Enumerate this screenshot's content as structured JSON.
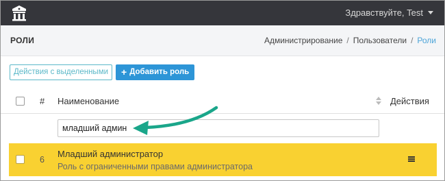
{
  "navbar": {
    "logo_icon": "building-logo-icon",
    "greeting": "Здравствуйте, Test"
  },
  "header": {
    "title": "РОЛИ",
    "breadcrumb": [
      "Администрирование",
      "Пользователи",
      "Роли"
    ],
    "separator": "/"
  },
  "toolbar": {
    "bulk_actions_label": "Действия с выделенными",
    "add_role_label": "Добавить роль",
    "add_icon": "plus-icon"
  },
  "table": {
    "columns": [
      "#",
      "Наименование",
      "Действия"
    ],
    "filter_value": "младший админ",
    "rows": [
      {
        "number": "6",
        "name": "Младший администратор",
        "description": "Роль с ограниченными правами администратора",
        "highlight_color": "#f9d131"
      }
    ]
  },
  "annotation": {
    "arrow_color": "#1aa68a"
  },
  "colors": {
    "navbar_bg": "#35363b",
    "accent_blue": "#2d95d7",
    "outline_teal": "#5bb8c8",
    "row_highlight": "#f9d131"
  }
}
